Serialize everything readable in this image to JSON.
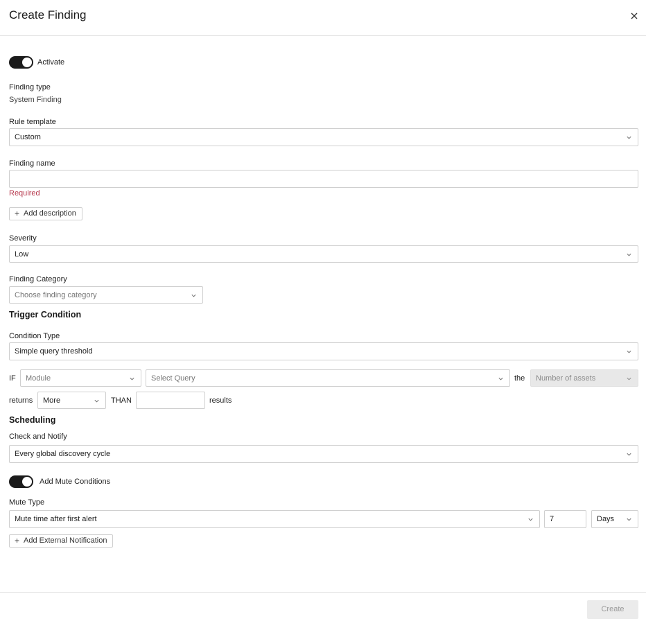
{
  "dialog": {
    "title": "Create Finding"
  },
  "activate": {
    "label": "Activate",
    "on": true
  },
  "finding_type": {
    "label": "Finding type",
    "value": "System Finding"
  },
  "rule_template": {
    "label": "Rule template",
    "value": "Custom"
  },
  "finding_name": {
    "label": "Finding name",
    "value": "",
    "error": "Required"
  },
  "add_description": {
    "label": "Add description"
  },
  "severity": {
    "label": "Severity",
    "value": "Low"
  },
  "finding_category": {
    "label": "Finding Category",
    "placeholder": "Choose finding category"
  },
  "trigger": {
    "heading": "Trigger Condition",
    "condition_type_label": "Condition Type",
    "condition_type_value": "Simple query threshold",
    "if_label": "IF",
    "module_placeholder": "Module",
    "query_placeholder": "Select Query",
    "the_label": "the",
    "assets_placeholder": "Number of assets",
    "returns_label": "returns",
    "comparison_value": "More",
    "than_label": "THAN",
    "threshold_value": "",
    "results_label": "results"
  },
  "scheduling": {
    "heading": "Scheduling",
    "check_label": "Check and Notify",
    "check_value": "Every global discovery cycle"
  },
  "mute": {
    "toggle_label": "Add Mute Conditions",
    "on": true,
    "type_label": "Mute Type",
    "type_value": "Mute time after first alert",
    "amount": "7",
    "unit": "Days"
  },
  "add_external_notification": {
    "label": "Add External Notification"
  },
  "footer": {
    "create_label": "Create"
  },
  "colors": {
    "toggle_on": "#1b1b1b",
    "error": "#b5354a",
    "disabled_bg": "#e8e8e8"
  }
}
